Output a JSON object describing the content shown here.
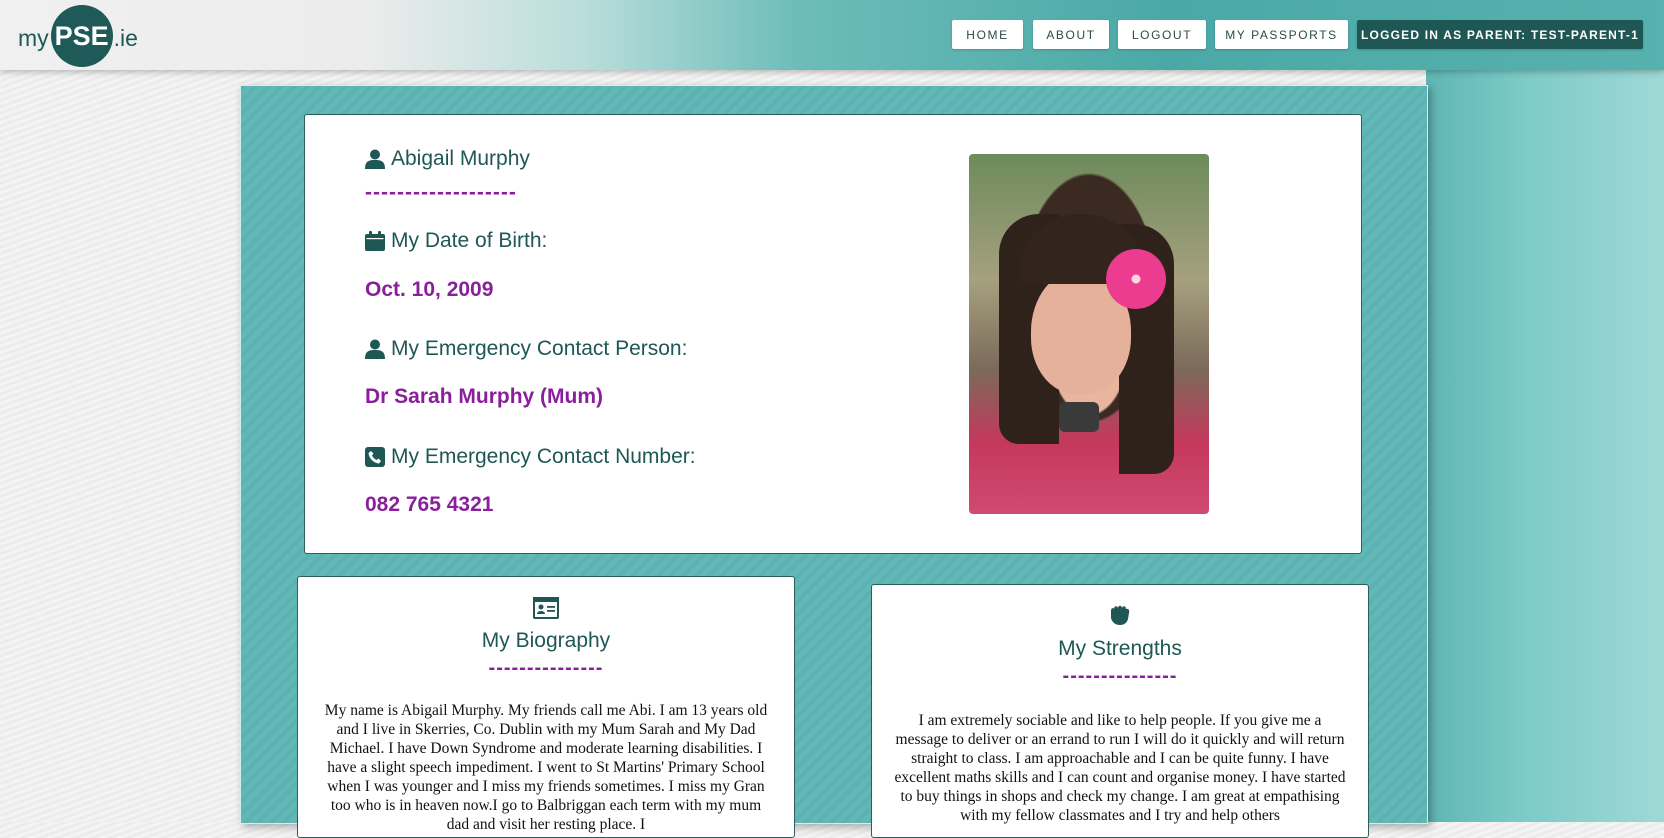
{
  "brand": {
    "prefix": "my",
    "circle": "PSE",
    "suffix": ".ie"
  },
  "nav": {
    "home": "HOME",
    "about": "ABOUT",
    "logout": "LOGOUT",
    "passports": "MY PASSPORTS",
    "user": "LOGGED IN AS PARENT: TEST-PARENT-1"
  },
  "profile": {
    "name": "Abigail Murphy",
    "name_dashes": "-------------------",
    "dob_label": "My Date of Birth:",
    "dob_value": "Oct. 10, 2009",
    "contact_label": "My Emergency Contact Person:",
    "contact_value": "Dr Sarah Murphy (Mum)",
    "number_label": "My Emergency Contact Number:",
    "number_value": "082 765 4321",
    "photo_icon": "profile-photo"
  },
  "biography": {
    "title": "My Biography",
    "dashes": "---------------",
    "icon": "id-card-icon",
    "text": "My name is Abigail Murphy. My friends call me Abi. I am 13 years old and I live in Skerries, Co. Dublin with my Mum Sarah and My Dad Michael. I have Down Syndrome and moderate learning disabilities. I have a slight speech impediment. I went to St Martins' Primary School when I was younger and I miss my friends sometimes. I miss my Gran too who is in heaven now.I go to Balbriggan each term with my mum dad and visit her resting place. I"
  },
  "strengths": {
    "title": "My Strengths",
    "dashes": "---------------",
    "icon": "fist-icon",
    "text": "I am extremely sociable and like to help people. If you give me a message to deliver or an errand to run I will do it quickly and will return straight to class. I am approachable and I can be quite funny. I have excellent maths skills and I can count and organise money. I have started to buy things in shops and check my change. I am great at empathising with my fellow classmates and I try and help others"
  },
  "colors": {
    "teal_dark": "#1f5755",
    "accent_purple": "#8a1f9c",
    "panel_teal": "#5bb2b0"
  }
}
